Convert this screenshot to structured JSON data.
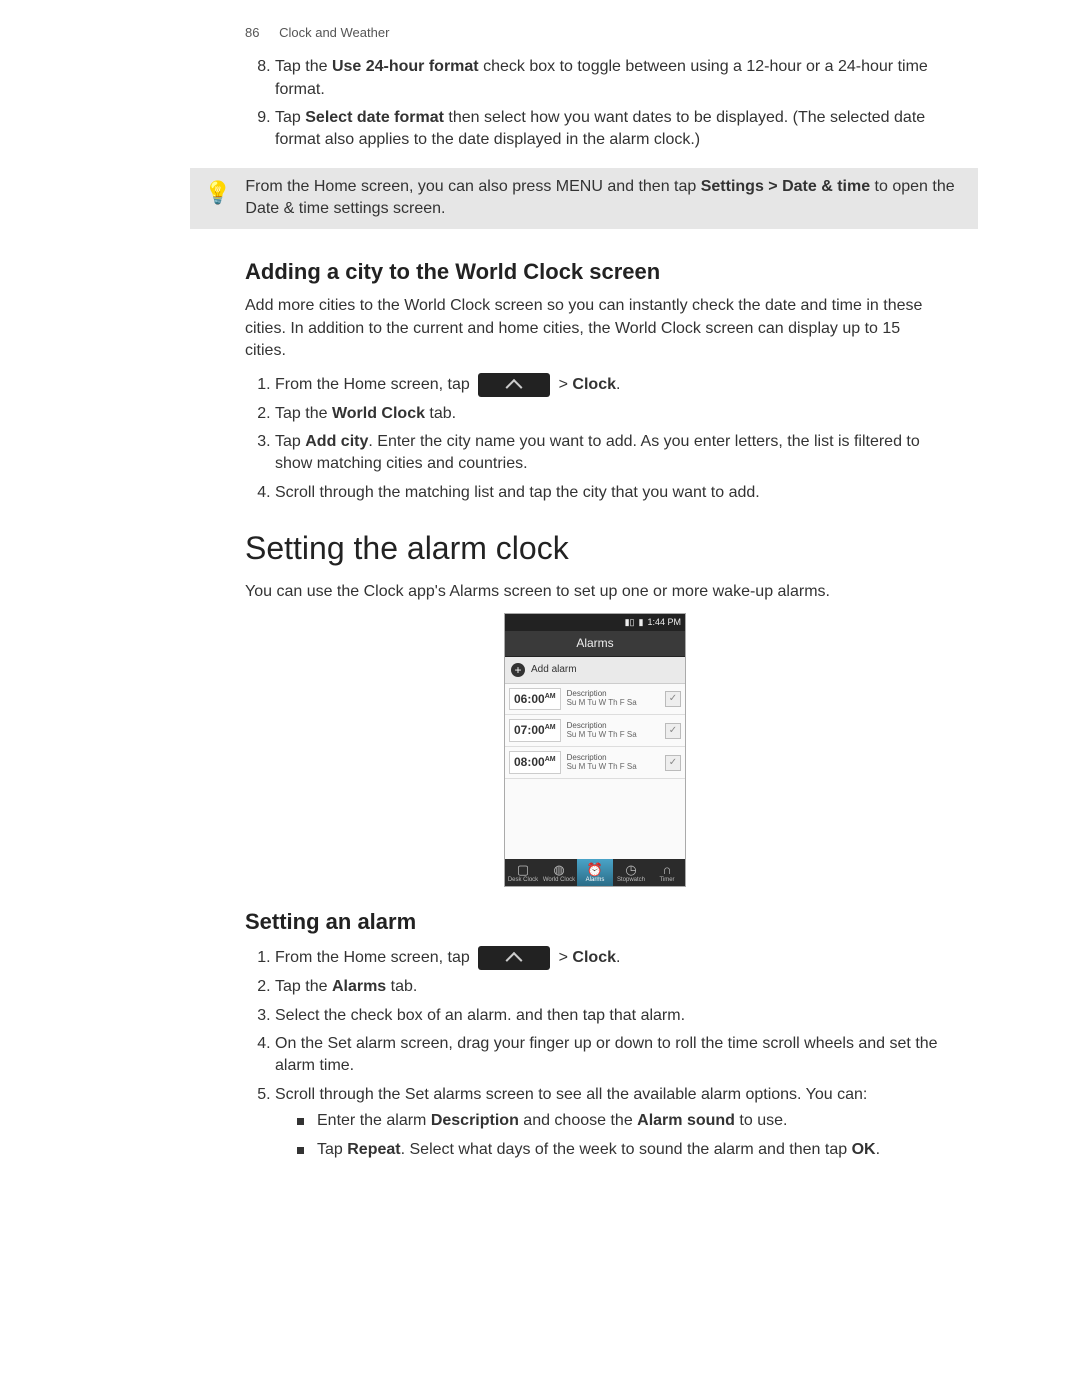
{
  "header": {
    "page_number": "86",
    "section": "Clock and Weather"
  },
  "step8": {
    "prefix": "Tap the ",
    "bold": "Use 24-hour format",
    "suffix": " check box to toggle between using a 12-hour or a 24-hour time format."
  },
  "step9": {
    "prefix": "Tap ",
    "bold": "Select date format",
    "suffix": " then select how you want dates to be displayed. (The selected date format also applies to the date displayed in the alarm clock.)"
  },
  "tip": {
    "prefix": "From the Home screen, you can also press MENU and then tap ",
    "bold": "Settings > Date & time",
    "suffix": " to open the Date & time settings screen."
  },
  "adding_city": {
    "title": "Adding a city to the World Clock screen",
    "intro": "Add more cities to the World Clock screen so you can instantly check the date and time in these cities. In addition to the current and home cities, the World Clock screen can display up to 15 cities.",
    "step1_prefix": "From the Home screen, tap ",
    "step1_suffix_prefix": " > ",
    "step1_suffix_bold": "Clock",
    "step1_suffix_end": ".",
    "step2_prefix": "Tap the ",
    "step2_bold": "World Clock",
    "step2_suffix": " tab.",
    "step3_prefix": "Tap ",
    "step3_bold": "Add city",
    "step3_suffix": ". Enter the city name you want to add. As you enter letters, the list is filtered to show matching cities and countries.",
    "step4": "Scroll through the matching list and tap the city that you want to add."
  },
  "setting_alarm_clock": {
    "title": "Setting the alarm clock",
    "intro": "You can use the Clock app's Alarms screen to set up one or more wake-up alarms."
  },
  "phone": {
    "status_time": "1:44 PM",
    "title": "Alarms",
    "add_label": "Add alarm",
    "rows": [
      {
        "time": "06:00",
        "ampm": "AM",
        "desc": "Description",
        "days": "Su M Tu W Th F Sa"
      },
      {
        "time": "07:00",
        "ampm": "AM",
        "desc": "Description",
        "days": "Su M Tu W Th F Sa"
      },
      {
        "time": "08:00",
        "ampm": "AM",
        "desc": "Description",
        "days": "Su M Tu W Th F Sa"
      }
    ],
    "tabs": [
      {
        "icon": "▢",
        "label": "Desk Clock"
      },
      {
        "icon": "◍",
        "label": "World Clock"
      },
      {
        "icon": "⏰",
        "label": "Alarms"
      },
      {
        "icon": "◷",
        "label": "Stopwatch"
      },
      {
        "icon": "∩",
        "label": "Timer"
      }
    ]
  },
  "setting_alarm": {
    "title": "Setting an alarm",
    "step1_prefix": "From the Home screen, tap ",
    "step1_suffix_prefix": " > ",
    "step1_suffix_bold": "Clock",
    "step1_suffix_end": ".",
    "step2_prefix": "Tap the ",
    "step2_bold": "Alarms",
    "step2_suffix": " tab.",
    "step3": "Select the check box of an alarm. and then tap that alarm.",
    "step4": "On the Set alarm screen, drag your finger up or down to roll the time scroll wheels and set the alarm time.",
    "step5": "Scroll through the Set alarms screen to see all the available alarm options. You can:",
    "bullet1_prefix": "Enter the alarm ",
    "bullet1_bold1": "Description",
    "bullet1_mid": " and choose the ",
    "bullet1_bold2": "Alarm sound",
    "bullet1_suffix": " to use.",
    "bullet2_prefix": "Tap ",
    "bullet2_bold1": "Repeat",
    "bullet2_mid": ". Select what days of the week to sound the alarm and then tap ",
    "bullet2_bold2": "OK",
    "bullet2_suffix": "."
  }
}
